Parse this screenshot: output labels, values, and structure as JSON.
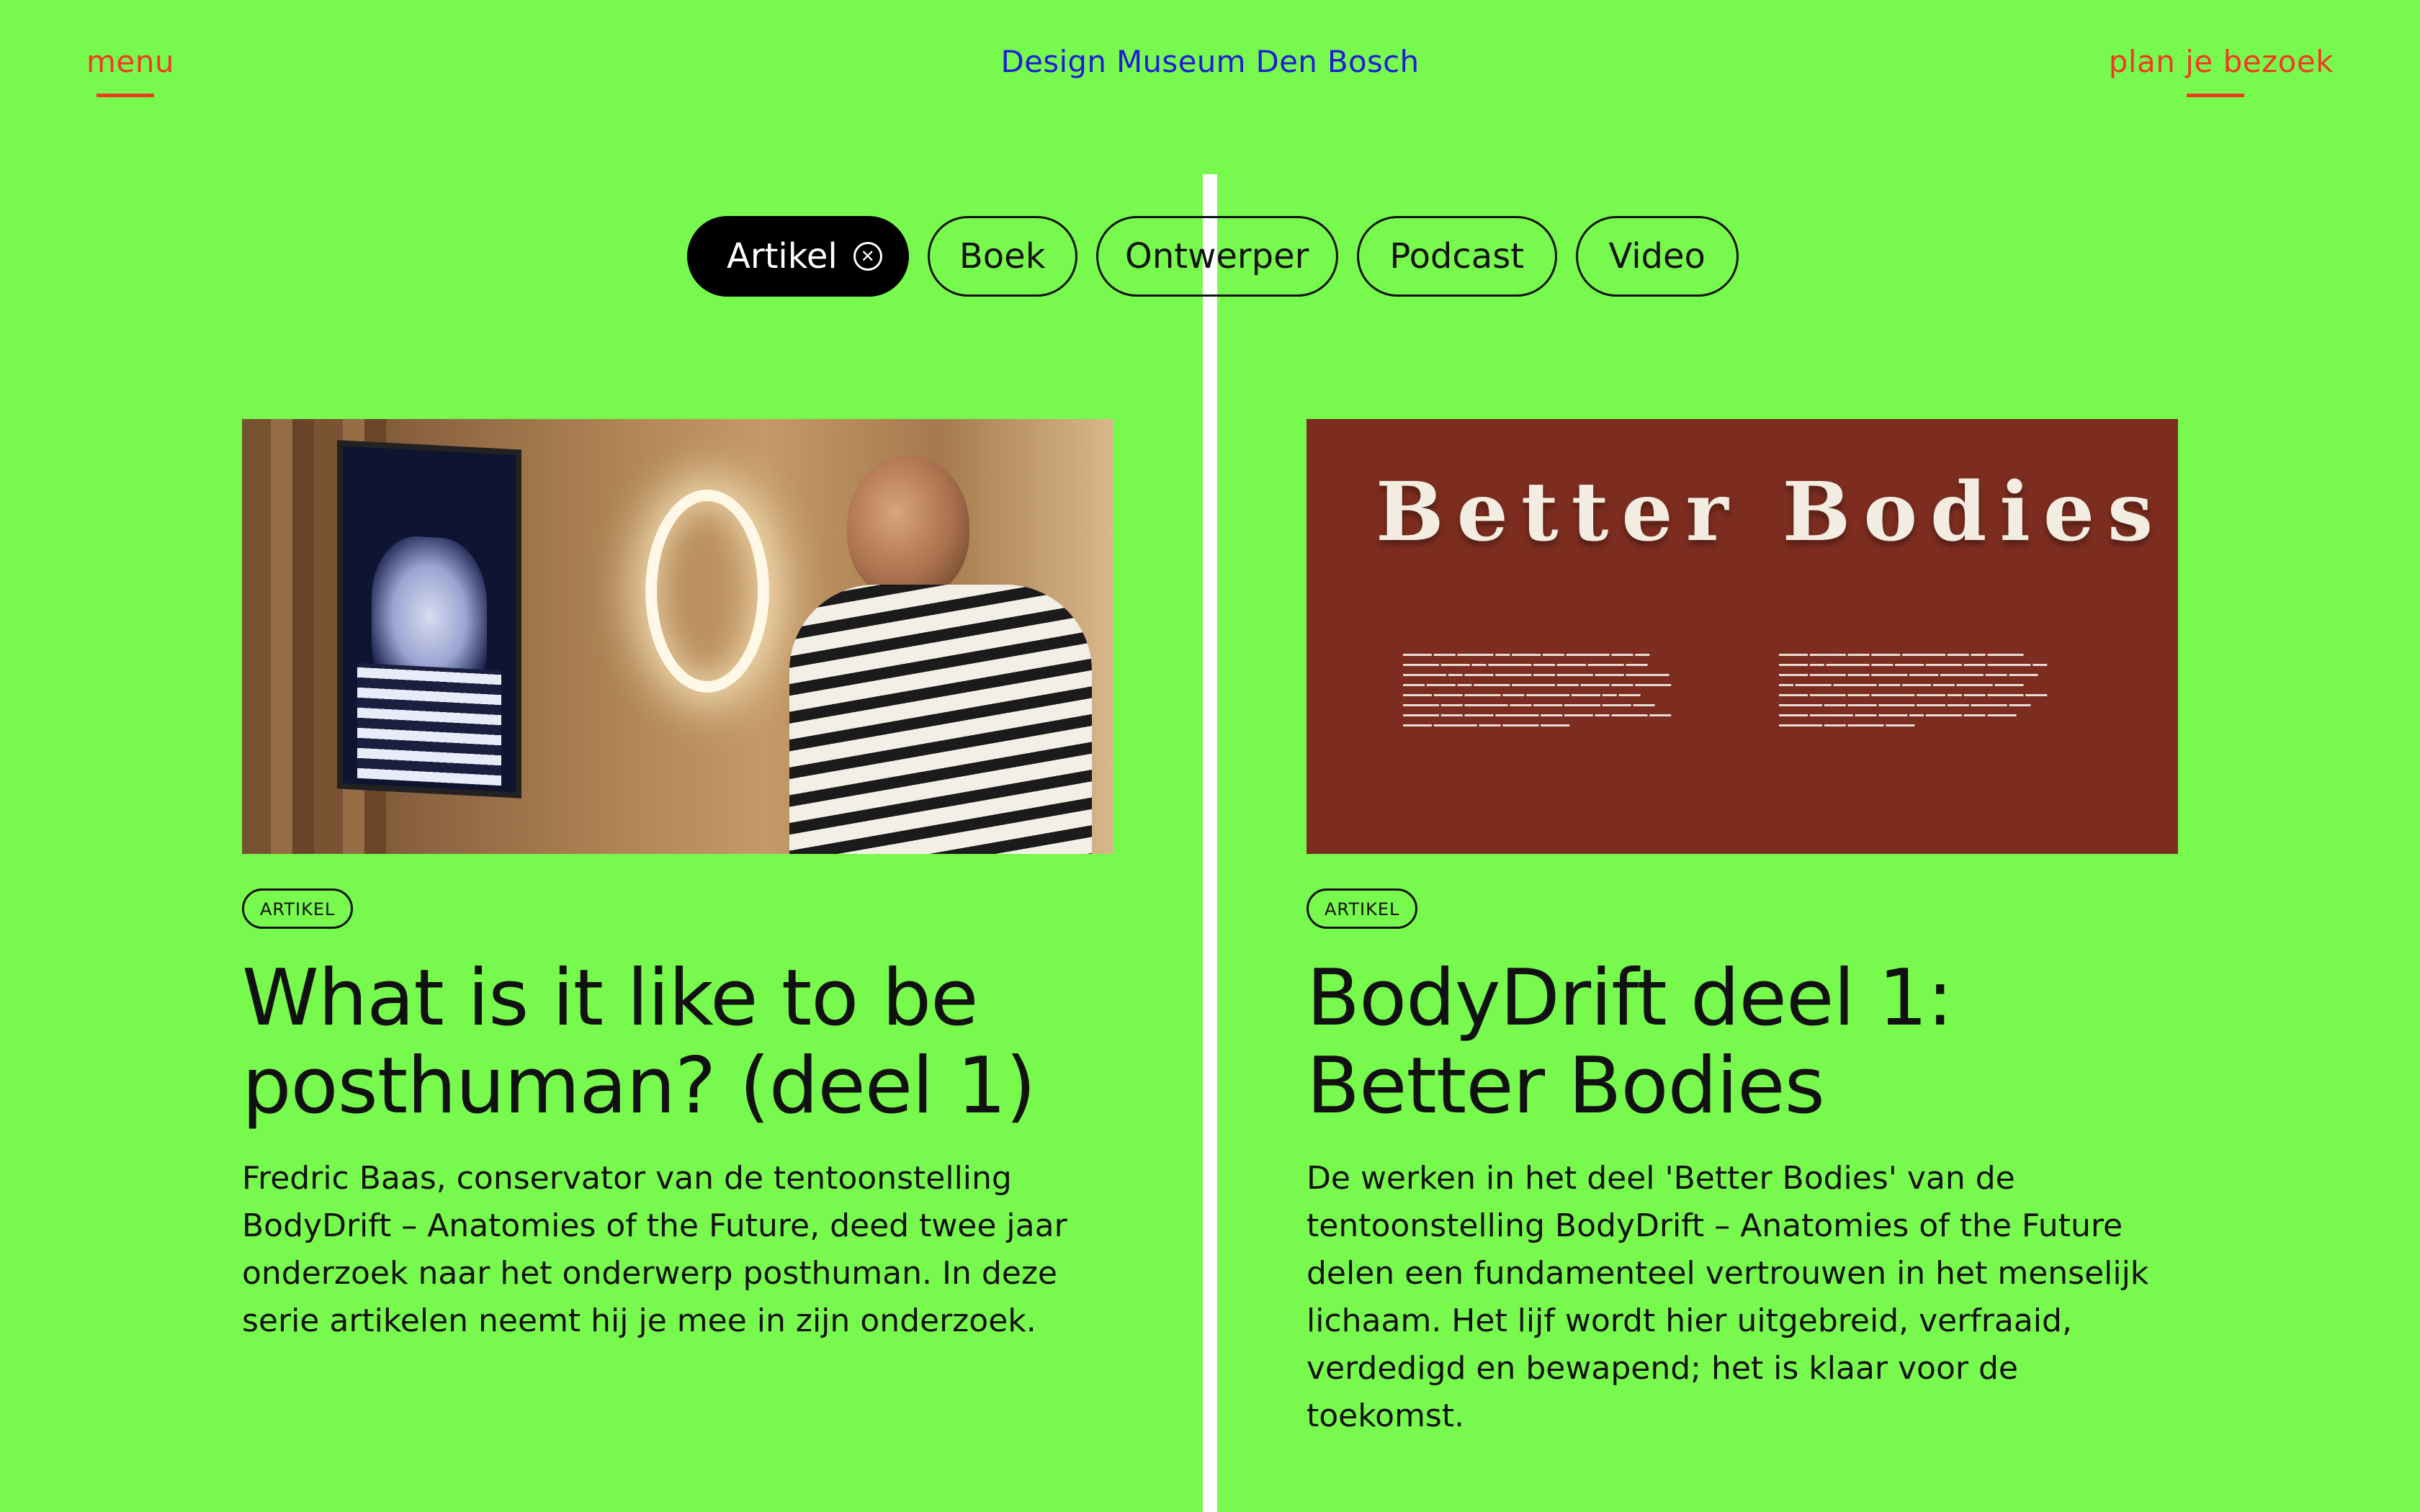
{
  "header": {
    "menu_label": "menu",
    "site_title": "Design Museum Den Bosch",
    "visit_label": "plan je bezoek"
  },
  "filters": {
    "items": [
      {
        "label": "Artikel",
        "active": true
      },
      {
        "label": "Boek",
        "active": false
      },
      {
        "label": "Ontwerper",
        "active": false
      },
      {
        "label": "Podcast",
        "active": false
      },
      {
        "label": "Video",
        "active": false
      }
    ],
    "clear_icon": "close-circle-icon"
  },
  "cards": [
    {
      "badge": "ARTIKEL",
      "title": "What is it like to be posthuman? (deel 1)",
      "description": "Fredric Baas, conservator van de tentoonstelling BodyDrift – Anatomies of the Future, deed twee jaar onderzoek naar het onderwerp posthuman. In deze serie artikelen neemt hij je mee in zijn onderzoek."
    },
    {
      "badge": "ARTIKEL",
      "title": "BodyDrift deel 1: Better Bodies",
      "description": "De werken in het deel 'Better Bodies' van de tentoonstelling BodyDrift – Anatomies of the Future delen een fundamenteel vertrouwen in het menselijk lichaam. Het lijf wordt hier uitgebreid, verfraaid, verdedigd en bewapend; het is klaar voor de toekomst.",
      "image_heading": "Better Bodies"
    }
  ],
  "colors": {
    "background": "#77fa4d",
    "nav_accent": "#f23a22",
    "title_blue": "#1d1dd6",
    "divider": "#ffffff"
  }
}
